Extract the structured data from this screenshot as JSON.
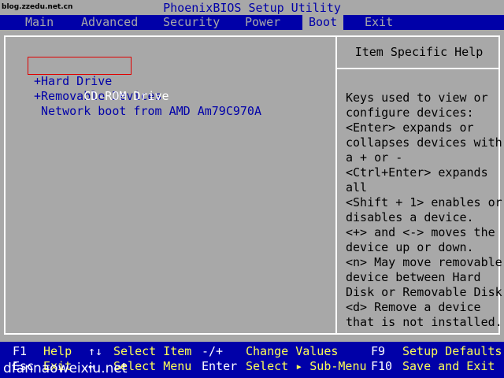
{
  "window": {
    "title": "PhoenixBIOS Setup Utility",
    "watermark_top": "blog.zzedu.net.cn",
    "watermark_bottom": "dfannaoweixiu.net"
  },
  "menu": {
    "tabs": [
      "Main",
      "Advanced",
      "Security",
      "Power",
      "Boot",
      "Exit"
    ],
    "active": "Boot"
  },
  "boot": {
    "items": [
      {
        "label": " CD-ROM Drive",
        "selected": true
      },
      {
        "label": "+Hard Drive",
        "selected": false
      },
      {
        "label": "+Removable Devices",
        "selected": false
      },
      {
        "label": " Network boot from AMD Am79C970A",
        "selected": false
      }
    ]
  },
  "help": {
    "title": "Item Specific Help",
    "lines": [
      "Keys used to view or",
      "configure devices:",
      "<Enter> expands or",
      "collapses devices with",
      "a + or -",
      "<Ctrl+Enter> expands",
      "all",
      "<Shift + 1> enables or",
      "disables a device.",
      "<+> and <-> moves the",
      "device up or down.",
      "<n> May move removable",
      "device between Hard",
      "Disk or Removable Disk",
      "<d> Remove a device",
      "that is not installed."
    ]
  },
  "footer": {
    "row1": {
      "k1": "F1",
      "d1": "Help",
      "k2": "↑↓",
      "d2": "Select Item",
      "k3": "-/+",
      "d3": "Change Values",
      "k4": "F9",
      "d4": "Setup Defaults"
    },
    "row2": {
      "k1": "Esc",
      "d1": "Exit",
      "k2": "↔",
      "d2": "Select Menu",
      "k3": "Enter",
      "d3": "Select ▸ Sub-Menu",
      "k4": "F10",
      "d4": "Save and Exit"
    }
  },
  "colors": {
    "background": "#a8a8a8",
    "menubar": "#0000a8",
    "footer_key": "#ffffff",
    "footer_desc": "#ffff55",
    "selection_box": "#e00000"
  }
}
